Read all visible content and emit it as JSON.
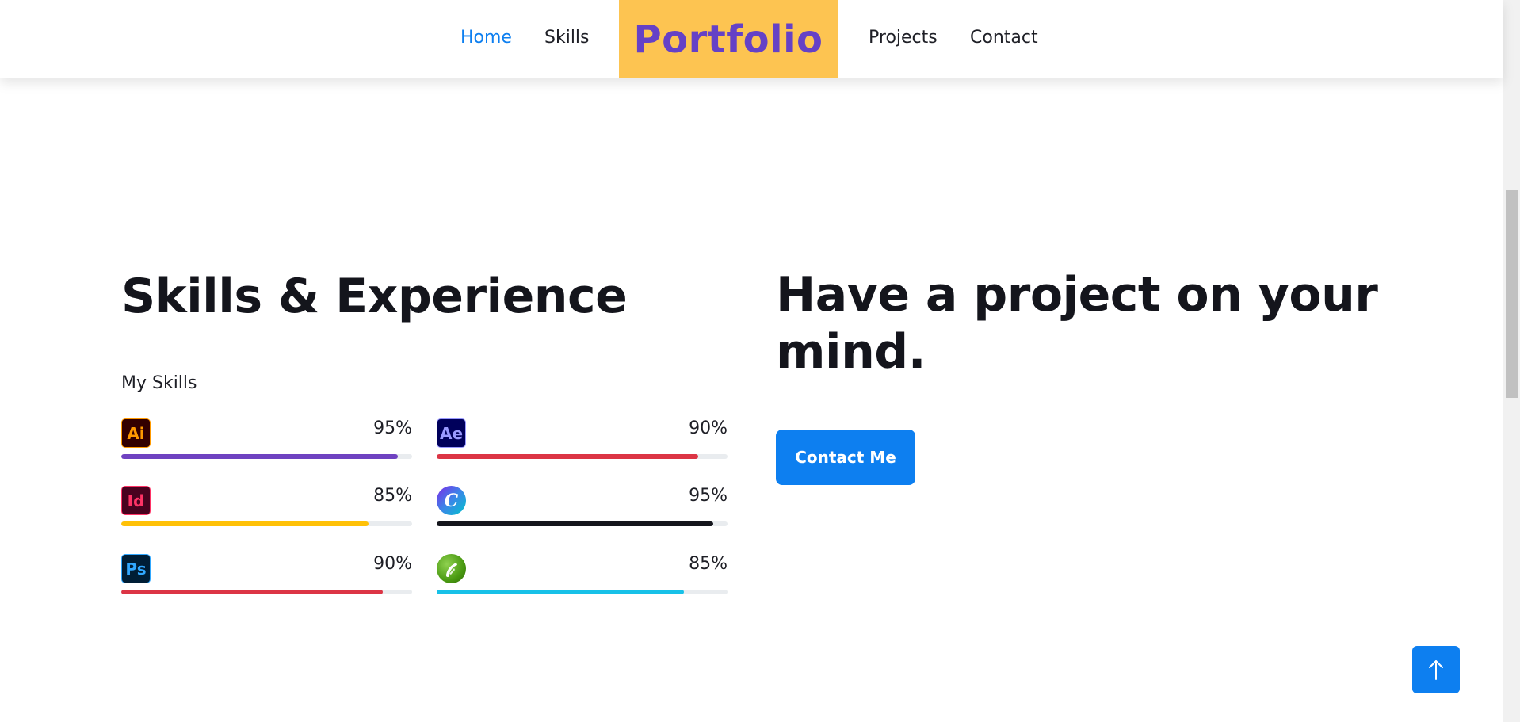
{
  "nav": {
    "links": [
      {
        "label": "Home",
        "active": true
      },
      {
        "label": "Skills",
        "active": false
      },
      {
        "label": "Projects",
        "active": false
      },
      {
        "label": "Contact",
        "active": false
      }
    ],
    "brand": "Portfolio"
  },
  "skills": {
    "title": "Skills & Experience",
    "subtitle": "My Skills",
    "items": [
      {
        "icon": "adobe-illustrator-icon",
        "icon_text": "Ai",
        "percent_label": "95%",
        "level": 0.95,
        "color": "#6f42c1"
      },
      {
        "icon": "adobe-after-effects-icon",
        "icon_text": "Ae",
        "percent_label": "90%",
        "level": 0.9,
        "color": "#dc3545"
      },
      {
        "icon": "adobe-indesign-icon",
        "icon_text": "Id",
        "percent_label": "85%",
        "level": 0.85,
        "color": "#ffc107"
      },
      {
        "icon": "canva-icon",
        "icon_text": "C",
        "percent_label": "95%",
        "level": 0.95,
        "color": "#14151c"
      },
      {
        "icon": "adobe-photoshop-icon",
        "icon_text": "Ps",
        "percent_label": "90%",
        "level": 0.9,
        "color": "#dc3545"
      },
      {
        "icon": "coreldraw-icon",
        "icon_text": "",
        "percent_label": "85%",
        "level": 0.85,
        "color": "#17c1e8"
      }
    ]
  },
  "contact": {
    "title": "Have a project on your mind.",
    "button_label": "Contact Me"
  },
  "colors": {
    "accent": "#0d7ff0",
    "brand_bg": "#fdc451",
    "brand_text": "#6541c6"
  }
}
